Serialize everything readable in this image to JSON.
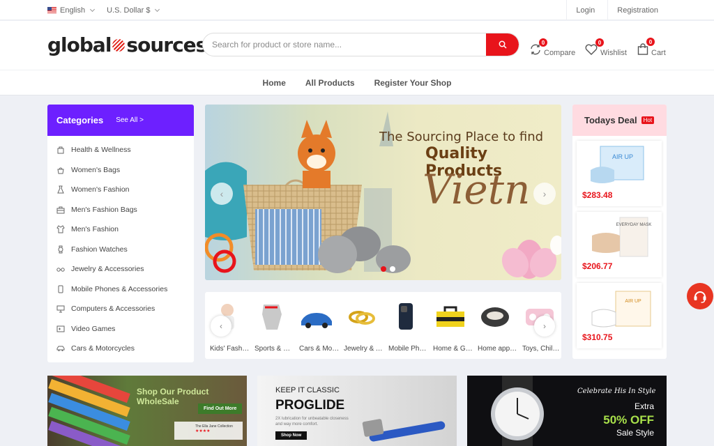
{
  "topbar": {
    "language": "English",
    "currency": "U.S. Dollar $",
    "login": "Login",
    "registration": "Registration"
  },
  "header": {
    "logo_left": "global",
    "logo_right": "sources",
    "search_placeholder": "Search for product or store name...",
    "compare": {
      "label": "Compare",
      "count": "0"
    },
    "wishlist": {
      "label": "Wishlist",
      "count": "0"
    },
    "cart": {
      "label": "Cart",
      "count": "0"
    }
  },
  "nav": [
    "Home",
    "All Products",
    "Register Your Shop"
  ],
  "categories": {
    "title": "Categories",
    "see_all": "See All >",
    "items": [
      {
        "label": "Health & Wellness",
        "icon": "bag-icon"
      },
      {
        "label": "Women's Bags",
        "icon": "handbag-icon"
      },
      {
        "label": "Women's Fashion",
        "icon": "dress-icon"
      },
      {
        "label": "Men's Fashion Bags",
        "icon": "briefcase-icon"
      },
      {
        "label": "Men's Fashion",
        "icon": "shirt-icon"
      },
      {
        "label": "Fashion Watches",
        "icon": "watch-icon"
      },
      {
        "label": "Jewelry & Accessories",
        "icon": "glasses-icon"
      },
      {
        "label": "Mobile Phones & Accessories",
        "icon": "phone-icon"
      },
      {
        "label": "Computers & Accessories",
        "icon": "computer-icon"
      },
      {
        "label": "Video Games",
        "icon": "game-icon"
      },
      {
        "label": "Cars & Motorcycles",
        "icon": "car-icon"
      }
    ]
  },
  "banner": {
    "line1": "The Sourcing Place to find",
    "line2": "Quality Products",
    "line3": "Vietn",
    "slide_count": 2,
    "active_slide": 1
  },
  "product_strip": [
    {
      "label": "Kids' Fashion",
      "icon": "baby-icon"
    },
    {
      "label": "Sports & Outdoors",
      "icon": "glove-icon"
    },
    {
      "label": "Cars & Motorcycles",
      "icon": "car-icon"
    },
    {
      "label": "Jewelry & Accessories",
      "icon": "ring-icon"
    },
    {
      "label": "Mobile Phones",
      "icon": "phone-icon"
    },
    {
      "label": "Home & Garden",
      "icon": "toolbox-icon"
    },
    {
      "label": "Home appliances",
      "icon": "pouf-icon"
    },
    {
      "label": "Toys, Children",
      "icon": "toy-icon"
    }
  ],
  "todays_deal": {
    "title": "Todays Deal",
    "badge": "Hot",
    "items": [
      {
        "price": "$283.48",
        "product_label": "AIR UP"
      },
      {
        "price": "$206.77",
        "product_label": "EVERYDAY MASK"
      },
      {
        "price": "$310.75",
        "product_label": "AIR UP"
      }
    ]
  },
  "promo": [
    {
      "title": "Shop Our Product WholeSale",
      "button": "Find Out More",
      "collection": "The Ella Jane Collection"
    },
    {
      "tagline": "KEEP IT CLASSIC",
      "title": "PROGLIDE",
      "subtitle": "2X lubrication for unbeatable closeness",
      "subtitle2": "and way more comfort.",
      "button": "Shop Now"
    },
    {
      "tagline": "Celebrate His In Style",
      "extra": "Extra",
      "offer": "50% OFF",
      "sub": "Sale Style"
    }
  ],
  "colors": {
    "accent": "#e8141b",
    "categories_header": "#6d20ff",
    "deal_header": "#ffdbe1"
  }
}
